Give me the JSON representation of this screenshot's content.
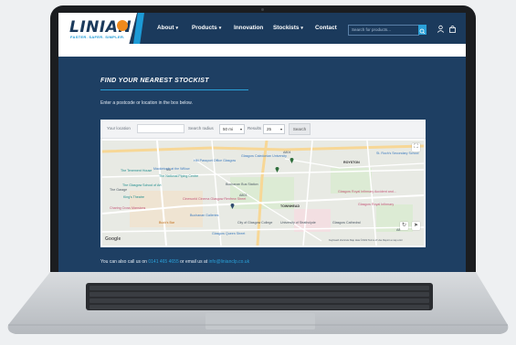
{
  "header": {
    "logo_text": "LINIAN",
    "logo_tagline": "FASTER. SAFER. SIMPLER.",
    "nav": [
      {
        "label": "About",
        "dropdown": true
      },
      {
        "label": "Products",
        "dropdown": true
      },
      {
        "label": "Innovation",
        "dropdown": false
      },
      {
        "label": "Stockists",
        "dropdown": true
      },
      {
        "label": "Contact",
        "dropdown": false
      }
    ],
    "search_placeholder": "Search for products..."
  },
  "page": {
    "title": "FIND YOUR NEAREST STOCKIST",
    "intro": "Enter a postcode or location in the box below."
  },
  "locator": {
    "location_label": "Your location",
    "location_value": "",
    "radius_label": "Search radius",
    "radius_value": "50 mi",
    "results_label": "Results",
    "results_value": "25",
    "search_button": "Search"
  },
  "map": {
    "labels": {
      "royston": "ROYSTON",
      "townhead": "TOWNHEAD",
      "tenement": "The Tenement House",
      "mackintosh": "Mackintosh at the Willow",
      "national_piping": "The National Piping Centre",
      "glasgow_school_art": "The Glasgow School of Art",
      "kings_theatre": "King's Theatre",
      "charing_cross": "Charing Cross Mansions",
      "buchanan_bus": "Buchanan Bus Station",
      "buchanan_galleries": "Buchanan Galleries",
      "royal_concert": "Glasgow Royal Concert Hall",
      "cineworld": "Cineworld Cinema Glasgow Renfrew Street",
      "university_strathclyde": "University of Strathclyde",
      "city_college": "City of Glasgow College",
      "glasgow_cathedral": "Glasgow Cathedral",
      "royal_infirmary": "Glasgow Royal Infirmary",
      "royal_infirmary_ae": "Glasgow Royal Infirmary Accident and...",
      "hmp_barlinnie": "HM Passport Office Glasgow",
      "caledonian": "Glasgow Caledonian University",
      "st_roch": "St. Roch's Secondary School",
      "queen_street": "Glasgow Queen Street",
      "bucks_bar": "Buck's Bar",
      "the_garage": "The Garage",
      "m8": "M8",
      "a804": "A804",
      "a803": "A803",
      "a8": "A8",
      "google": "Google",
      "attribution": "Keyboard shortcuts  Map data ©2022  Terms of Use  Report a map error"
    }
  },
  "footer": {
    "text_before": "You can also call us on",
    "phone": "0141 465 4655",
    "text_middle": "or email us at",
    "email": "info@linianclp.co.uk"
  },
  "colors": {
    "navy": "#1b3a5c",
    "page_bg": "#1e3f63",
    "accent_blue": "#2aa0d8",
    "logo_orange": "#f08a1c"
  }
}
